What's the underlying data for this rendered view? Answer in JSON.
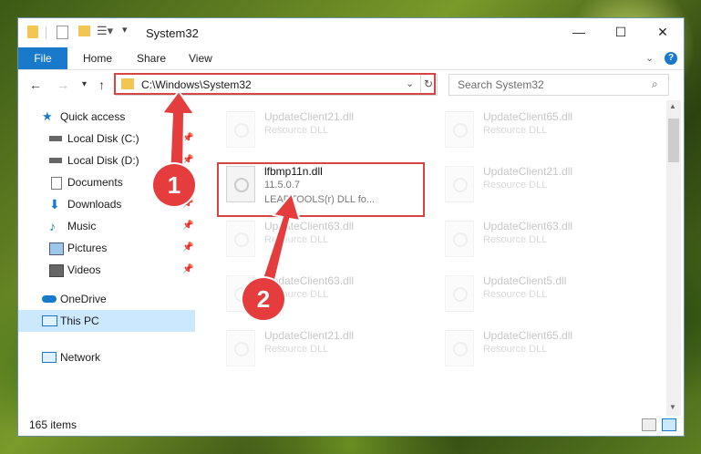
{
  "window": {
    "title": "System32"
  },
  "ribbon": {
    "tabs": [
      "File",
      "Home",
      "Share",
      "View"
    ]
  },
  "address": {
    "path": "C:\\Windows\\System32"
  },
  "search": {
    "placeholder": "Search System32"
  },
  "sidebar": {
    "items": [
      {
        "label": "Quick access"
      },
      {
        "label": "Local Disk (C:)"
      },
      {
        "label": "Local Disk (D:)"
      },
      {
        "label": "Documents"
      },
      {
        "label": "Downloads"
      },
      {
        "label": "Music"
      },
      {
        "label": "Pictures"
      },
      {
        "label": "Videos"
      },
      {
        "label": "OneDrive"
      },
      {
        "label": "This PC"
      },
      {
        "label": "Network"
      }
    ]
  },
  "files": {
    "highlight": {
      "name": "lfbmp11n.dll",
      "version": "11.5.0.7",
      "description": "LEADTOOLS(r) DLL fo..."
    },
    "tiles": [
      {
        "name": "UpdateClient21.dll",
        "type": "Resource DLL"
      },
      {
        "name": "UpdateClient65.dll",
        "type": "Resource DLL"
      },
      {
        "name": "UpdateClient21.dll",
        "type": "Resource DLL"
      },
      {
        "name": "UpdateClient63.dll",
        "type": "Resource DLL"
      },
      {
        "name": "UpdateClient63.dll",
        "type": "Resource DLL"
      },
      {
        "name": "UpdateClient5.dll",
        "type": "Resource DLL"
      },
      {
        "name": "UpdateClient21.dll",
        "type": "Resource DLL"
      },
      {
        "name": "UpdateClient65.dll",
        "type": "Resource DLL"
      }
    ]
  },
  "status": {
    "items": "165 items"
  },
  "callouts": {
    "one": "1",
    "two": "2"
  },
  "colors": {
    "accent": "#1979ca",
    "highlight_red": "#d64545",
    "callout_red": "#e53d3d",
    "selected": "#cce8ff"
  }
}
